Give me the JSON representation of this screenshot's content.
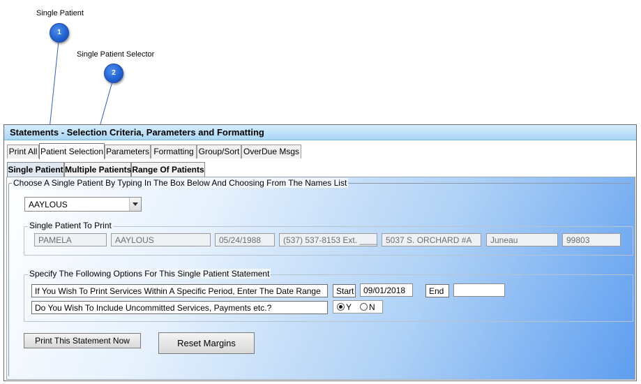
{
  "callouts": [
    {
      "number": "1",
      "label": "Single Patient"
    },
    {
      "number": "2",
      "label": "Single Patient Selector"
    }
  ],
  "window": {
    "title": "Statements - Selection Criteria, Parameters and Formatting"
  },
  "tabs": [
    "Print All",
    "Patient Selection",
    "Parameters",
    "Formatting",
    "Group/Sort",
    "OverDue Msgs"
  ],
  "active_tab": "Patient Selection",
  "subtabs": [
    "Single Patient",
    "Multiple Patients",
    "Range Of Patients"
  ],
  "active_subtab": "Single Patient",
  "choose_group": {
    "legend": "Choose A Single Patient By Typing In The Box Below And Choosing From The Names List",
    "patient_select": {
      "value": "AAYLOUS"
    }
  },
  "patient_to_print": {
    "legend": "Single Patient To Print",
    "first_name": "PAMELA",
    "last_name": "AAYLOUS",
    "dob": "05/24/1988",
    "phone": "(537) 537-8153 Ext. _____",
    "address": "5037 S. ORCHARD #A",
    "city": "Juneau",
    "zip": "99803"
  },
  "options": {
    "legend": "Specify The Following Options For This Single Patient Statement",
    "date_range_label": "If You Wish To Print Services Within A Specific Period, Enter The Date Range",
    "start_label": "Start",
    "start_value": "09/01/2018",
    "end_label": "End",
    "end_value": "",
    "uncommitted_label": "Do You Wish To Include Uncommitted Services, Payments etc.?",
    "yes_label": "Y",
    "no_label": "N",
    "selected": "Y"
  },
  "buttons": {
    "print_now": "Print This Statement Now",
    "reset_margins": "Reset Margins"
  },
  "colors": {
    "callout": "#1f5fd0",
    "title_bar": "#a9d6f6",
    "panel_accent": "#5e9ef0"
  }
}
